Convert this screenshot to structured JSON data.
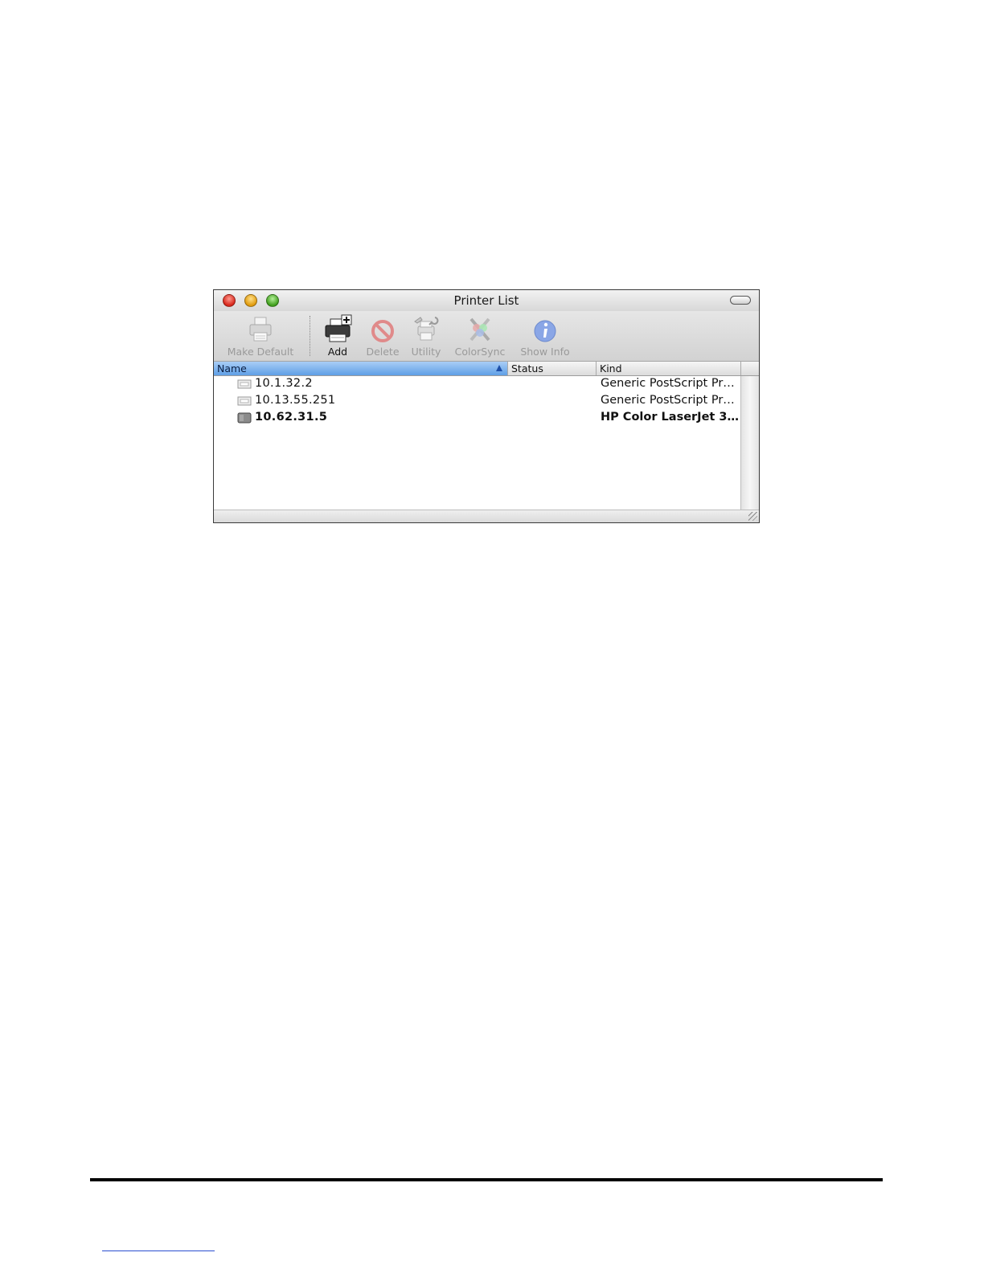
{
  "window": {
    "title": "Printer List"
  },
  "toolbar": {
    "items": [
      {
        "label": "Make Default",
        "icon": "printer-default-icon",
        "enabled": false
      },
      {
        "label": "Add",
        "icon": "printer-add-icon",
        "enabled": true
      },
      {
        "label": "Delete",
        "icon": "delete-icon",
        "enabled": false
      },
      {
        "label": "Utility",
        "icon": "utility-icon",
        "enabled": false
      },
      {
        "label": "ColorSync",
        "icon": "colorsync-icon",
        "enabled": false
      },
      {
        "label": "Show Info",
        "icon": "info-icon",
        "enabled": false
      }
    ]
  },
  "list": {
    "columns": {
      "name": "Name",
      "status": "Status",
      "kind": "Kind"
    },
    "sort": {
      "column": "Name",
      "direction": "ascending"
    },
    "rows": [
      {
        "name": "10.1.32.2",
        "status": "",
        "kind": "Generic PostScript Pr…",
        "icon": "generic-printer-icon",
        "is_default": false
      },
      {
        "name": "10.13.55.251",
        "status": "",
        "kind": "Generic PostScript Pr…",
        "icon": "generic-printer-icon",
        "is_default": false
      },
      {
        "name": "10.62.31.5",
        "status": "",
        "kind": "HP Color LaserJet 3…",
        "icon": "laserjet-printer-icon",
        "is_default": true
      }
    ]
  },
  "colors": {
    "header_selected": "#6aa6ea",
    "link_underline": "#2a4fd0"
  }
}
